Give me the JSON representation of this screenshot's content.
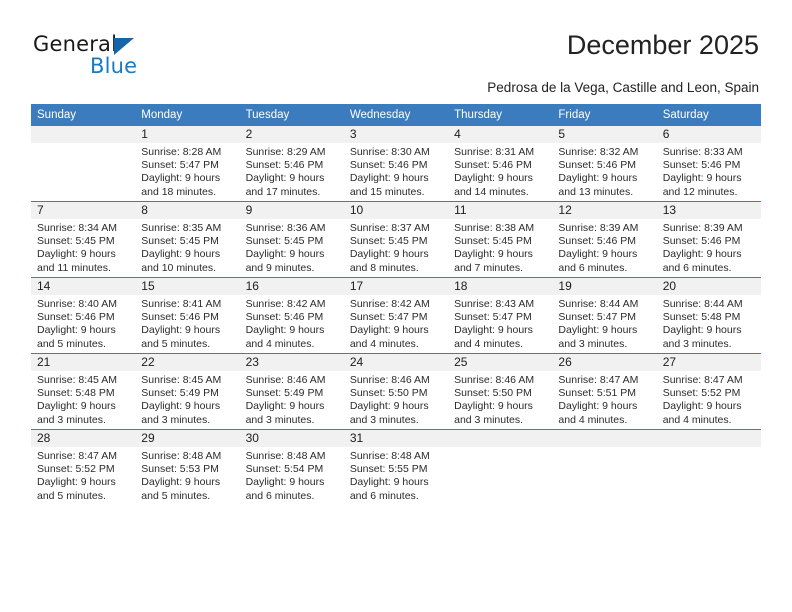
{
  "brand": {
    "name_top": "General",
    "name_bottom": "Blue",
    "color_blue": "#1a7ac4",
    "triangle_color": "#1565a8"
  },
  "header": {
    "title": "December 2025",
    "subtitle": "Pedrosa de la Vega, Castille and Leon, Spain"
  },
  "calendar": {
    "header_bg": "#3a7cbe",
    "daynum_bg": "#f1f1f1",
    "weekdays": [
      "Sunday",
      "Monday",
      "Tuesday",
      "Wednesday",
      "Thursday",
      "Friday",
      "Saturday"
    ],
    "weeks": [
      [
        {
          "day": "",
          "blank": true
        },
        {
          "day": "1",
          "sunrise": "Sunrise: 8:28 AM",
          "sunset": "Sunset: 5:47 PM",
          "daylight1": "Daylight: 9 hours",
          "daylight2": "and 18 minutes."
        },
        {
          "day": "2",
          "sunrise": "Sunrise: 8:29 AM",
          "sunset": "Sunset: 5:46 PM",
          "daylight1": "Daylight: 9 hours",
          "daylight2": "and 17 minutes."
        },
        {
          "day": "3",
          "sunrise": "Sunrise: 8:30 AM",
          "sunset": "Sunset: 5:46 PM",
          "daylight1": "Daylight: 9 hours",
          "daylight2": "and 15 minutes."
        },
        {
          "day": "4",
          "sunrise": "Sunrise: 8:31 AM",
          "sunset": "Sunset: 5:46 PM",
          "daylight1": "Daylight: 9 hours",
          "daylight2": "and 14 minutes."
        },
        {
          "day": "5",
          "sunrise": "Sunrise: 8:32 AM",
          "sunset": "Sunset: 5:46 PM",
          "daylight1": "Daylight: 9 hours",
          "daylight2": "and 13 minutes."
        },
        {
          "day": "6",
          "sunrise": "Sunrise: 8:33 AM",
          "sunset": "Sunset: 5:46 PM",
          "daylight1": "Daylight: 9 hours",
          "daylight2": "and 12 minutes."
        }
      ],
      [
        {
          "day": "7",
          "sunrise": "Sunrise: 8:34 AM",
          "sunset": "Sunset: 5:45 PM",
          "daylight1": "Daylight: 9 hours",
          "daylight2": "and 11 minutes."
        },
        {
          "day": "8",
          "sunrise": "Sunrise: 8:35 AM",
          "sunset": "Sunset: 5:45 PM",
          "daylight1": "Daylight: 9 hours",
          "daylight2": "and 10 minutes."
        },
        {
          "day": "9",
          "sunrise": "Sunrise: 8:36 AM",
          "sunset": "Sunset: 5:45 PM",
          "daylight1": "Daylight: 9 hours",
          "daylight2": "and 9 minutes."
        },
        {
          "day": "10",
          "sunrise": "Sunrise: 8:37 AM",
          "sunset": "Sunset: 5:45 PM",
          "daylight1": "Daylight: 9 hours",
          "daylight2": "and 8 minutes."
        },
        {
          "day": "11",
          "sunrise": "Sunrise: 8:38 AM",
          "sunset": "Sunset: 5:45 PM",
          "daylight1": "Daylight: 9 hours",
          "daylight2": "and 7 minutes."
        },
        {
          "day": "12",
          "sunrise": "Sunrise: 8:39 AM",
          "sunset": "Sunset: 5:46 PM",
          "daylight1": "Daylight: 9 hours",
          "daylight2": "and 6 minutes."
        },
        {
          "day": "13",
          "sunrise": "Sunrise: 8:39 AM",
          "sunset": "Sunset: 5:46 PM",
          "daylight1": "Daylight: 9 hours",
          "daylight2": "and 6 minutes."
        }
      ],
      [
        {
          "day": "14",
          "sunrise": "Sunrise: 8:40 AM",
          "sunset": "Sunset: 5:46 PM",
          "daylight1": "Daylight: 9 hours",
          "daylight2": "and 5 minutes."
        },
        {
          "day": "15",
          "sunrise": "Sunrise: 8:41 AM",
          "sunset": "Sunset: 5:46 PM",
          "daylight1": "Daylight: 9 hours",
          "daylight2": "and 5 minutes."
        },
        {
          "day": "16",
          "sunrise": "Sunrise: 8:42 AM",
          "sunset": "Sunset: 5:46 PM",
          "daylight1": "Daylight: 9 hours",
          "daylight2": "and 4 minutes."
        },
        {
          "day": "17",
          "sunrise": "Sunrise: 8:42 AM",
          "sunset": "Sunset: 5:47 PM",
          "daylight1": "Daylight: 9 hours",
          "daylight2": "and 4 minutes."
        },
        {
          "day": "18",
          "sunrise": "Sunrise: 8:43 AM",
          "sunset": "Sunset: 5:47 PM",
          "daylight1": "Daylight: 9 hours",
          "daylight2": "and 4 minutes."
        },
        {
          "day": "19",
          "sunrise": "Sunrise: 8:44 AM",
          "sunset": "Sunset: 5:47 PM",
          "daylight1": "Daylight: 9 hours",
          "daylight2": "and 3 minutes."
        },
        {
          "day": "20",
          "sunrise": "Sunrise: 8:44 AM",
          "sunset": "Sunset: 5:48 PM",
          "daylight1": "Daylight: 9 hours",
          "daylight2": "and 3 minutes."
        }
      ],
      [
        {
          "day": "21",
          "sunrise": "Sunrise: 8:45 AM",
          "sunset": "Sunset: 5:48 PM",
          "daylight1": "Daylight: 9 hours",
          "daylight2": "and 3 minutes."
        },
        {
          "day": "22",
          "sunrise": "Sunrise: 8:45 AM",
          "sunset": "Sunset: 5:49 PM",
          "daylight1": "Daylight: 9 hours",
          "daylight2": "and 3 minutes."
        },
        {
          "day": "23",
          "sunrise": "Sunrise: 8:46 AM",
          "sunset": "Sunset: 5:49 PM",
          "daylight1": "Daylight: 9 hours",
          "daylight2": "and 3 minutes."
        },
        {
          "day": "24",
          "sunrise": "Sunrise: 8:46 AM",
          "sunset": "Sunset: 5:50 PM",
          "daylight1": "Daylight: 9 hours",
          "daylight2": "and 3 minutes."
        },
        {
          "day": "25",
          "sunrise": "Sunrise: 8:46 AM",
          "sunset": "Sunset: 5:50 PM",
          "daylight1": "Daylight: 9 hours",
          "daylight2": "and 3 minutes."
        },
        {
          "day": "26",
          "sunrise": "Sunrise: 8:47 AM",
          "sunset": "Sunset: 5:51 PM",
          "daylight1": "Daylight: 9 hours",
          "daylight2": "and 4 minutes."
        },
        {
          "day": "27",
          "sunrise": "Sunrise: 8:47 AM",
          "sunset": "Sunset: 5:52 PM",
          "daylight1": "Daylight: 9 hours",
          "daylight2": "and 4 minutes."
        }
      ],
      [
        {
          "day": "28",
          "sunrise": "Sunrise: 8:47 AM",
          "sunset": "Sunset: 5:52 PM",
          "daylight1": "Daylight: 9 hours",
          "daylight2": "and 5 minutes."
        },
        {
          "day": "29",
          "sunrise": "Sunrise: 8:48 AM",
          "sunset": "Sunset: 5:53 PM",
          "daylight1": "Daylight: 9 hours",
          "daylight2": "and 5 minutes."
        },
        {
          "day": "30",
          "sunrise": "Sunrise: 8:48 AM",
          "sunset": "Sunset: 5:54 PM",
          "daylight1": "Daylight: 9 hours",
          "daylight2": "and 6 minutes."
        },
        {
          "day": "31",
          "sunrise": "Sunrise: 8:48 AM",
          "sunset": "Sunset: 5:55 PM",
          "daylight1": "Daylight: 9 hours",
          "daylight2": "and 6 minutes."
        },
        {
          "day": "",
          "blank": true
        },
        {
          "day": "",
          "blank": true
        },
        {
          "day": "",
          "blank": true
        }
      ]
    ]
  }
}
